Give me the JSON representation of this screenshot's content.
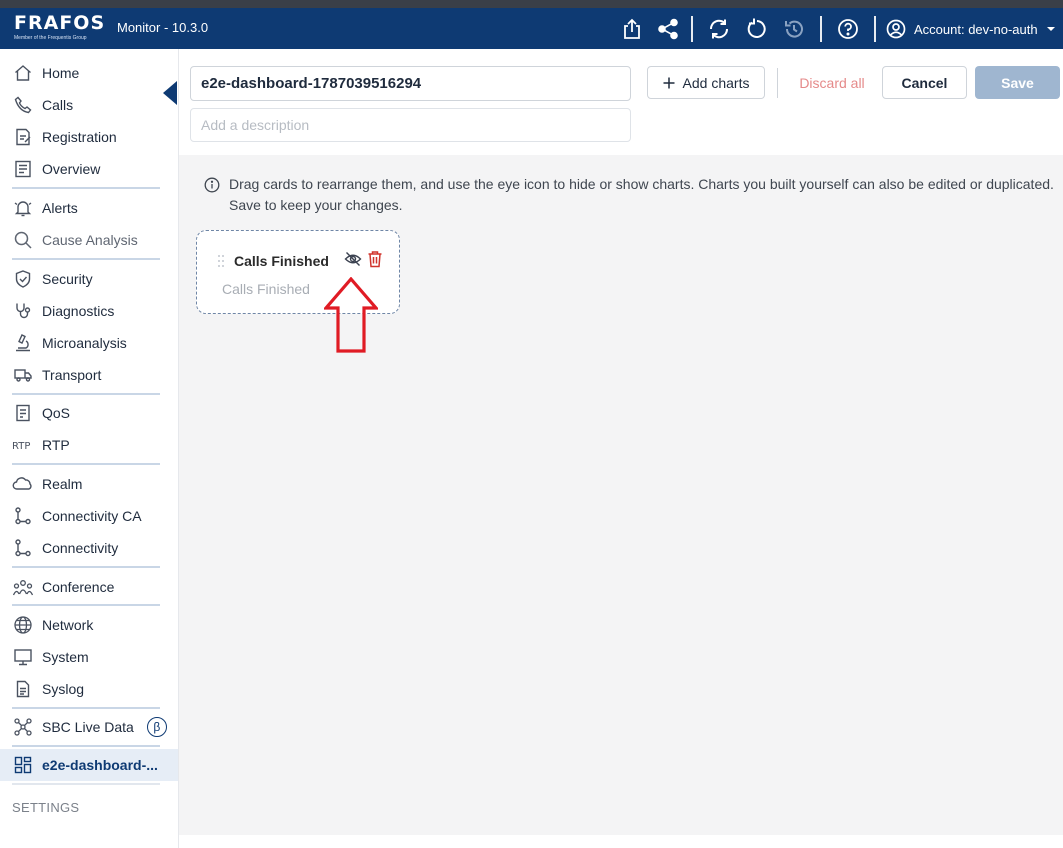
{
  "app": {
    "title": "Monitor - 10.3.0",
    "logo_text": "FRAFOS",
    "logo_subtitle": "Member of the Frequentis Group",
    "account_label": "Account: dev-no-auth"
  },
  "toolbar_icons": [
    "export-icon",
    "share-icon",
    "sync-icon",
    "refresh-icon",
    "history-icon",
    "help-icon"
  ],
  "sidebar": {
    "items": [
      {
        "label": "Home",
        "icon": "home-icon"
      },
      {
        "label": "Calls",
        "icon": "phone-icon"
      },
      {
        "label": "Registration",
        "icon": "registration-icon"
      },
      {
        "label": "Overview",
        "icon": "overview-icon"
      },
      {
        "label": "Alerts",
        "icon": "alert-bell-icon"
      },
      {
        "label": "Cause Analysis",
        "icon": "magnifier-icon"
      },
      {
        "label": "Security",
        "icon": "shield-icon"
      },
      {
        "label": "Diagnostics",
        "icon": "stethoscope-icon"
      },
      {
        "label": "Microanalysis",
        "icon": "microscope-icon"
      },
      {
        "label": "Transport",
        "icon": "truck-icon"
      },
      {
        "label": "QoS",
        "icon": "qos-icon"
      },
      {
        "label": "RTP",
        "icon": "rtp-icon"
      },
      {
        "label": "Realm",
        "icon": "cloud-icon"
      },
      {
        "label": "Connectivity CA",
        "icon": "connectivity-icon"
      },
      {
        "label": "Connectivity",
        "icon": "connectivity-icon"
      },
      {
        "label": "Conference",
        "icon": "people-icon"
      },
      {
        "label": "Network",
        "icon": "globe-icon"
      },
      {
        "label": "System",
        "icon": "monitor-icon"
      },
      {
        "label": "Syslog",
        "icon": "document-icon"
      },
      {
        "label": "SBC Live Data",
        "icon": "graph-icon"
      },
      {
        "label": "e2e-dashboard-...",
        "icon": "dashboard-icon"
      }
    ],
    "beta_badge": "β",
    "settings_label": "SETTINGS"
  },
  "editor": {
    "title_value": "e2e-dashboard-1787039516294",
    "description_placeholder": "Add a description",
    "add_charts_label": "Add charts",
    "discard_label": "Discard all",
    "cancel_label": "Cancel",
    "save_label": "Save"
  },
  "info_text": "Drag cards to rearrange them, and use the eye icon to hide or show charts. Charts you built yourself can also be edited or duplicated. Save to keep your changes.",
  "cards": [
    {
      "title": "Calls Finished",
      "subtitle": "Calls Finished",
      "visible": false
    }
  ],
  "colors": {
    "brand": "#0e3a73",
    "annotation_arrow": "#e01b24",
    "delete": "#d0342c",
    "save_disabled": "#9fb6d0"
  }
}
